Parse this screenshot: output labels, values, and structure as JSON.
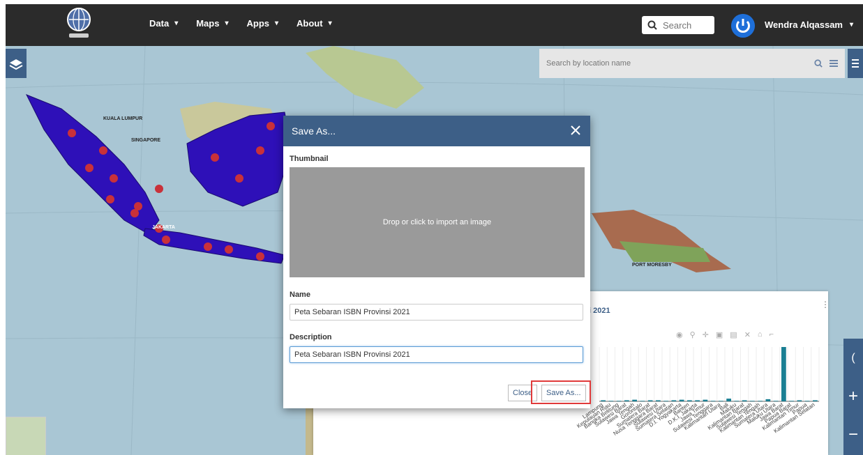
{
  "nav": {
    "items": [
      {
        "label": "Data"
      },
      {
        "label": "Maps"
      },
      {
        "label": "Apps"
      },
      {
        "label": "About"
      }
    ],
    "search_placeholder": "Search",
    "user_name": "Wendra Alqassam"
  },
  "map": {
    "location_search_placeholder": "Search by location name",
    "labels": {
      "kuala_lumpur": "KUALA LUMPUR",
      "singapore": "SINGAPORE",
      "jakarta": "JAKARTA",
      "port_moresby": "PORT MORESBY"
    },
    "zoom_in_label": "+",
    "zoom_out_label": "−"
  },
  "chart": {
    "title": "i 2021",
    "menu_label": "⋮",
    "toolbar_icons": [
      "camera-icon",
      "zoom-icon",
      "pan-icon",
      "box-select-icon",
      "lasso-icon",
      "reset-icon",
      "home-icon",
      "spike-icon"
    ]
  },
  "chart_data": {
    "type": "bar",
    "categories": [
      "Lampung",
      "Kepulauan Riau",
      "Bangka Belitung",
      "Sulawesi Barat",
      "Jawa Tengah",
      "Gorontalo",
      "Sumatera Barat",
      "Nusa Tenggara Barat",
      "Sulawesi Utara",
      "Sumatera Selatan",
      "D.I. Yogyakarta",
      "Banten",
      "D.K.I. Jakarta",
      "Jawa Timur",
      "Sulawesi Tenggara",
      "Kalimantan Utara",
      "Bali",
      "Maluku",
      "Kalimantan Barat",
      "Sulawesi Tengah",
      "Kalimantan Tengah",
      "Sumatera Utara",
      "Maluku Utara",
      "Jawa Barat",
      "Papua Barat",
      "Kalimantan Timur",
      "Papua",
      "Kalimantan Selatan"
    ],
    "values": [
      2,
      1,
      1,
      2,
      3,
      1,
      2,
      2,
      1,
      2,
      3,
      2,
      2,
      3,
      1,
      1,
      5,
      1,
      2,
      1,
      1,
      4,
      1,
      100,
      1,
      2,
      1,
      2
    ],
    "ylim": [
      0,
      100
    ]
  },
  "dialog": {
    "title": "Save As...",
    "thumbnail_label": "Thumbnail",
    "thumbnail_hint": "Drop or click to import an image",
    "name_label": "Name",
    "name_value": "Peta Sebaran ISBN Provinsi 2021",
    "description_label": "Description",
    "description_value": "Peta Sebaran ISBN Provinsi 2021",
    "close_label": "Close",
    "save_label": "Save As..."
  },
  "colors": {
    "topbar": "#2b2b2b",
    "header": "#3d5f87",
    "province_fill": "#2e10b8",
    "marker": "#c9313a",
    "bar": "#1a7f93",
    "highlight": "#e03a3a"
  }
}
